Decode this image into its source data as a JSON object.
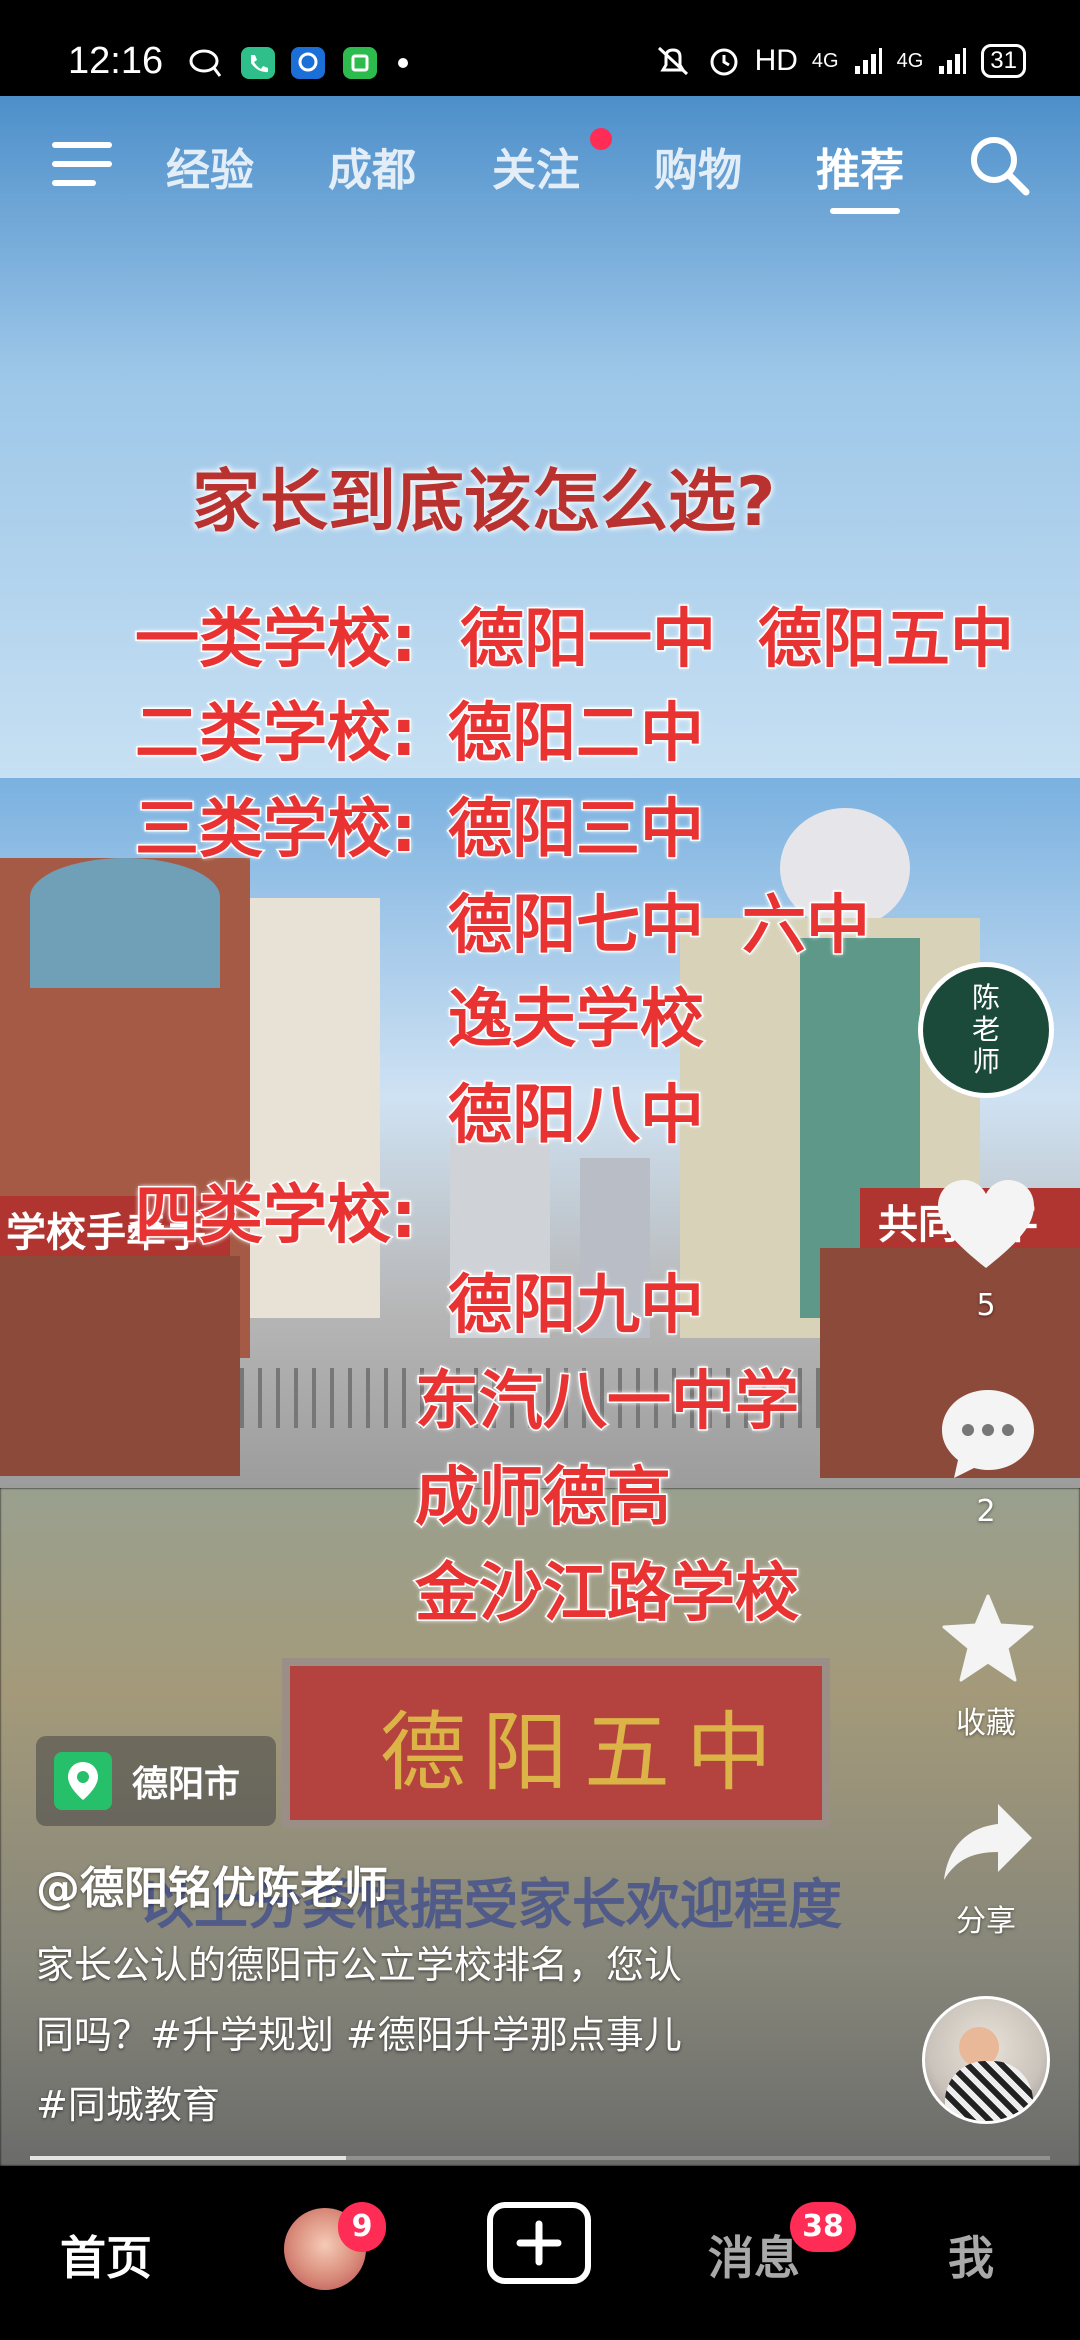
{
  "status_bar": {
    "time": "12:16",
    "hd": "HD",
    "net1": "4G",
    "net2": "4G",
    "battery": "31"
  },
  "top_nav": {
    "tabs": [
      {
        "label": "经验",
        "active": false
      },
      {
        "label": "成都",
        "active": false
      },
      {
        "label": "关注",
        "active": false,
        "has_dot": true
      },
      {
        "label": "购物",
        "active": false
      },
      {
        "label": "推荐",
        "active": true
      }
    ]
  },
  "video_overlay": {
    "title": "家长到底该怎么选?",
    "lines": [
      "一类学校:",
      "德阳一中",
      "德阳五中",
      "二类学校:",
      "德阳二中",
      "三类学校:",
      "德阳三中",
      "德阳七中",
      "六中",
      "逸夫学校",
      "德阳八中",
      "四类学校:",
      "德阳九中",
      "东汽八一中学",
      "成师德高",
      "金沙江路学校"
    ],
    "bottom_caption": "以上分类根据受家长欢迎程度",
    "banner_left": "学校手牵手",
    "banner_right": "共同创平",
    "gate_sign": "德阳五中"
  },
  "right_rail": {
    "author_avatar_text": [
      "陈",
      "老",
      "师"
    ],
    "like_count": "5",
    "comment_count": "2",
    "favorite_label": "收藏",
    "share_label": "分享"
  },
  "location": {
    "label": "德阳市"
  },
  "post": {
    "author": "@德阳铭优陈老师",
    "description_line1": "家长公认的德阳市公立学校排名，您认",
    "description_line2": "同吗？#升学规划 #德阳升学那点事儿",
    "description_line3": "#同城教育",
    "progress": 0.31
  },
  "bottom_nav": {
    "home": "首页",
    "friends_badge": "9",
    "messages": "消息",
    "messages_badge": "38",
    "me": "我"
  },
  "colors": {
    "overlay_red": "#e93232",
    "badge_red": "#ff2c55",
    "location_green": "#27c06a"
  }
}
